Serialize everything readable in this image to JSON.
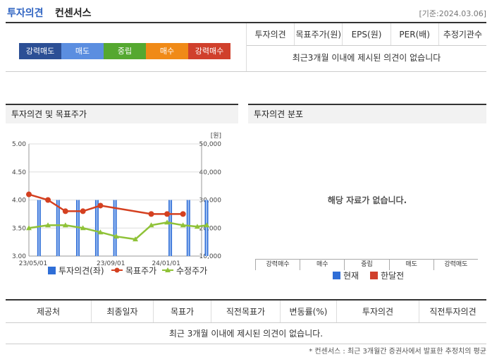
{
  "header": {
    "title_a": "투자의견",
    "title_b": "컨센서스",
    "date_label": "[기준:2024.03.06]"
  },
  "opinion_bar": [
    {
      "label": "강력매도",
      "color": "#2c4f95"
    },
    {
      "label": "매도",
      "color": "#5b8ee0"
    },
    {
      "label": "중립",
      "color": "#55a830"
    },
    {
      "label": "매수",
      "color": "#f08a17"
    },
    {
      "label": "강력매수",
      "color": "#d0402c"
    }
  ],
  "consensus": {
    "headers": [
      "투자의견",
      "목표주가(원)",
      "EPS(원)",
      "PER(배)",
      "추정기관수"
    ],
    "empty_message": "최근3개월 이내에 제시된 의견이 없습니다"
  },
  "panel1": {
    "title": "투자의견 및 목표주가"
  },
  "panel2": {
    "title": "투자의견 분포"
  },
  "chart_data": [
    {
      "type": "bar+line",
      "title": "",
      "x_ticks": [
        "23/05/01",
        "23/09/01",
        "24/01/01"
      ],
      "y_left_ticks": [
        "5.00",
        "4.50",
        "4.00",
        "3.50",
        "3.00"
      ],
      "y_right_ticks": [
        "50,000",
        "40,000",
        "30,000",
        "20,000",
        "10,000"
      ],
      "y_right_unit": "[원]",
      "ylim_left": [
        3.0,
        5.0
      ],
      "ylim_right": [
        10000,
        50000
      ],
      "bar_values": [
        4,
        4,
        4,
        4,
        4,
        4,
        4,
        4,
        4,
        4
      ],
      "bar_positions": [
        0.03,
        0.14,
        0.255,
        0.365,
        0.47,
        0.79,
        0.895,
        1.0,
        0.0,
        0.0
      ],
      "bar_count": 8,
      "series": [
        {
          "name": "투자의견(좌)",
          "kind": "bar",
          "color": "#2f6ed7"
        },
        {
          "name": "목표주가",
          "kind": "line",
          "color": "#d44020",
          "points": [
            [
              0.0,
              32000
            ],
            [
              0.12,
              30000
            ],
            [
              0.23,
              26000
            ],
            [
              0.34,
              26000
            ],
            [
              0.45,
              28000
            ],
            [
              0.77,
              25000
            ],
            [
              0.87,
              25000
            ],
            [
              0.97,
              25000
            ]
          ]
        },
        {
          "name": "수정주가",
          "kind": "line",
          "color": "#8fc238",
          "points": [
            [
              0.0,
              20000
            ],
            [
              0.12,
              21000
            ],
            [
              0.23,
              21000
            ],
            [
              0.34,
              20000
            ],
            [
              0.45,
              18500
            ],
            [
              0.55,
              17000
            ],
            [
              0.67,
              16000
            ],
            [
              0.77,
              21000
            ],
            [
              0.87,
              22000
            ],
            [
              0.97,
              21000
            ],
            [
              1.06,
              20500
            ],
            [
              1.12,
              21000
            ]
          ]
        }
      ],
      "legend": "bottom"
    },
    {
      "type": "bar",
      "categories": [
        "강력매수",
        "매수",
        "중립",
        "매도",
        "강력매도"
      ],
      "values": [],
      "empty_message": "해당 자료가 없습니다.",
      "series": [
        {
          "name": "현재",
          "color": "#2f6ed7"
        },
        {
          "name": "한달전",
          "color": "#d0402c"
        }
      ]
    }
  ],
  "history_table": {
    "headers": [
      "제공처",
      "최종일자",
      "목표가",
      "직전목표가",
      "변동률(%)",
      "투자의견",
      "직전투자의견"
    ],
    "empty_message": "최근 3개월 이내에 제시된 의견이 없습니다."
  },
  "footnote": "* 컨센서스 : 최근 3개월간 증권사에서 발표한 추정치의 평균"
}
